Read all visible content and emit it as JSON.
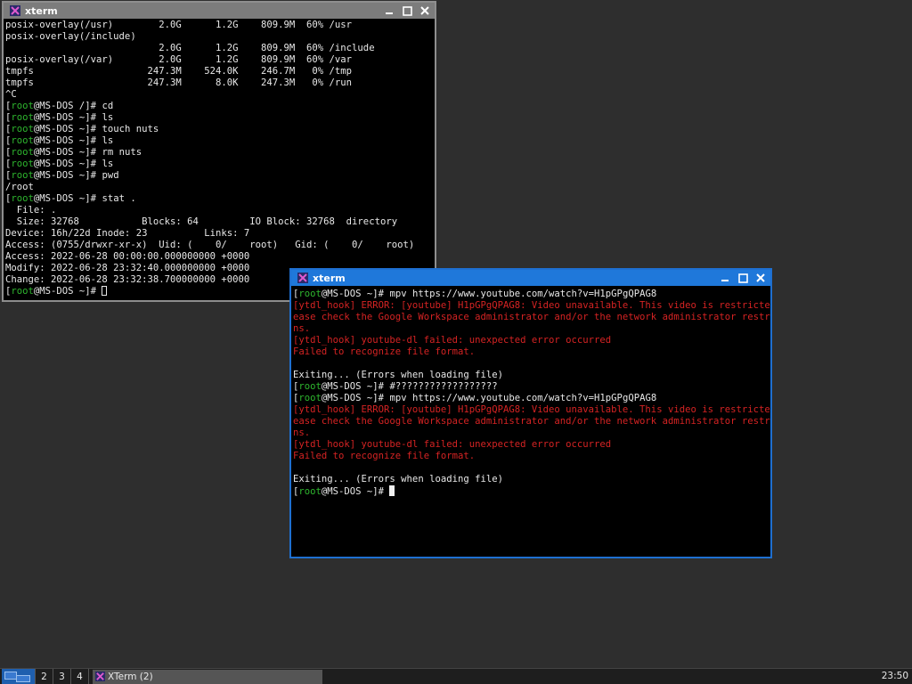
{
  "windows": [
    {
      "title": "xterm",
      "icon": "xterm-x-icon",
      "lines": [
        [
          [
            "w",
            "posix-overlay(/usr)        2.0G      1.2G    809.9M  60% /usr"
          ]
        ],
        [
          [
            "w",
            "posix-overlay(/include)"
          ]
        ],
        [
          [
            "w",
            "                           2.0G      1.2G    809.9M  60% /include"
          ]
        ],
        [
          [
            "w",
            "posix-overlay(/var)        2.0G      1.2G    809.9M  60% /var"
          ]
        ],
        [
          [
            "w",
            "tmpfs                    247.3M    524.0K    246.7M   0% /tmp"
          ]
        ],
        [
          [
            "w",
            "tmpfs                    247.3M      8.0K    247.3M   0% /run"
          ]
        ],
        [
          [
            "w",
            "^C"
          ]
        ],
        [
          [
            "w",
            "["
          ],
          [
            "g",
            "root"
          ],
          [
            "w",
            "@MS-DOS /]# cd"
          ]
        ],
        [
          [
            "w",
            "["
          ],
          [
            "g",
            "root"
          ],
          [
            "w",
            "@MS-DOS ~]# ls"
          ]
        ],
        [
          [
            "w",
            "["
          ],
          [
            "g",
            "root"
          ],
          [
            "w",
            "@MS-DOS ~]# touch nuts"
          ]
        ],
        [
          [
            "w",
            "["
          ],
          [
            "g",
            "root"
          ],
          [
            "w",
            "@MS-DOS ~]# ls"
          ]
        ],
        [
          [
            "w",
            "["
          ],
          [
            "g",
            "root"
          ],
          [
            "w",
            "@MS-DOS ~]# rm nuts"
          ]
        ],
        [
          [
            "w",
            "["
          ],
          [
            "g",
            "root"
          ],
          [
            "w",
            "@MS-DOS ~]# ls"
          ]
        ],
        [
          [
            "w",
            "["
          ],
          [
            "g",
            "root"
          ],
          [
            "w",
            "@MS-DOS ~]# pwd"
          ]
        ],
        [
          [
            "w",
            "/root"
          ]
        ],
        [
          [
            "w",
            "["
          ],
          [
            "g",
            "root"
          ],
          [
            "w",
            "@MS-DOS ~]# stat ."
          ]
        ],
        [
          [
            "w",
            "  File: ."
          ]
        ],
        [
          [
            "w",
            "  Size: 32768           Blocks: 64         IO Block: 32768  directory"
          ]
        ],
        [
          [
            "w",
            "Device: 16h/22d Inode: 23          Links: 7"
          ]
        ],
        [
          [
            "w",
            "Access: (0755/drwxr-xr-x)  Uid: (    0/    root)   Gid: (    0/    root)"
          ]
        ],
        [
          [
            "w",
            "Access: 2022-06-28 00:00:00.000000000 +0000"
          ]
        ],
        [
          [
            "w",
            "Modify: 2022-06-28 23:32:40.000000000 +0000"
          ]
        ],
        [
          [
            "w",
            "Change: 2022-06-28 23:32:38.700000000 +0000"
          ]
        ],
        [
          [
            "w",
            "["
          ],
          [
            "g",
            "root"
          ],
          [
            "w",
            "@MS-DOS ~]# "
          ]
        ]
      ]
    },
    {
      "title": "xterm",
      "icon": "xterm-x-icon",
      "lines": [
        [
          [
            "w",
            "["
          ],
          [
            "g",
            "root"
          ],
          [
            "w",
            "@MS-DOS ~]# mpv https://www.youtube.com/watch?v=H1pGPgQPAG8"
          ]
        ],
        [
          [
            "r",
            "[ytdl_hook] ERROR: [youtube] H1pGPgQPAG8: Video unavailable. This video is restricted. Pl"
          ]
        ],
        [
          [
            "r",
            "ease check the Google Workspace administrator and/or the network administrator restrictio"
          ]
        ],
        [
          [
            "r",
            "ns."
          ]
        ],
        [
          [
            "r",
            "[ytdl_hook] youtube-dl failed: unexpected error occurred"
          ]
        ],
        [
          [
            "r",
            "Failed to recognize file format."
          ]
        ],
        [
          [
            "w",
            ""
          ]
        ],
        [
          [
            "w",
            "Exiting... (Errors when loading file)"
          ]
        ],
        [
          [
            "w",
            "["
          ],
          [
            "g",
            "root"
          ],
          [
            "w",
            "@MS-DOS ~]# #??????????????????"
          ]
        ],
        [
          [
            "w",
            "["
          ],
          [
            "g",
            "root"
          ],
          [
            "w",
            "@MS-DOS ~]# mpv https://www.youtube.com/watch?v=H1pGPgQPAG8"
          ]
        ],
        [
          [
            "r",
            "[ytdl_hook] ERROR: [youtube] H1pGPgQPAG8: Video unavailable. This video is restricted. Pl"
          ]
        ],
        [
          [
            "r",
            "ease check the Google Workspace administrator and/or the network administrator restrictio"
          ]
        ],
        [
          [
            "r",
            "ns."
          ]
        ],
        [
          [
            "r",
            "[ytdl_hook] youtube-dl failed: unexpected error occurred"
          ]
        ],
        [
          [
            "r",
            "Failed to recognize file format."
          ]
        ],
        [
          [
            "w",
            ""
          ]
        ],
        [
          [
            "w",
            "Exiting... (Errors when loading file)"
          ]
        ],
        [
          [
            "w",
            "["
          ],
          [
            "g",
            "root"
          ],
          [
            "w",
            "@MS-DOS ~]# "
          ]
        ]
      ]
    }
  ],
  "colors": {
    "prompt_user": "#2eb62e",
    "error_text": "#d52323",
    "text": "#e8e8e8",
    "active_titlebar": "#1f78da",
    "inactive_titlebar": "#7c7c7c"
  },
  "taskbar": {
    "desktops": [
      "1",
      "2",
      "3",
      "4"
    ],
    "active_desktop": "1",
    "task_label": "XTerm (2)",
    "clock": "23:50"
  }
}
